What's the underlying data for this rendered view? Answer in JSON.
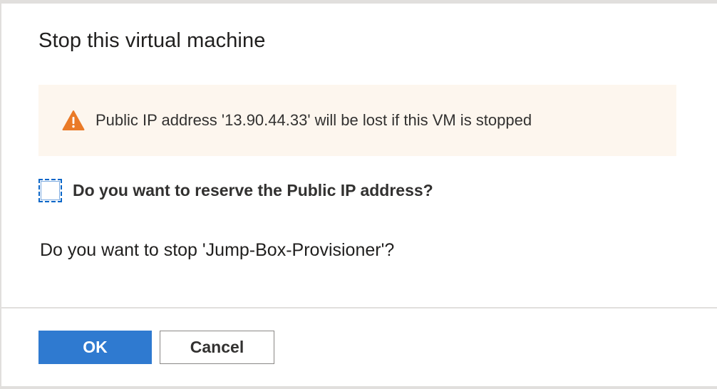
{
  "dialog": {
    "title": "Stop this virtual machine",
    "warning": {
      "icon": "warning-triangle-icon",
      "text": "Public IP address '13.90.44.33' will be lost if this VM is stopped",
      "background": "#fdf6ee",
      "icon_color": "#ea7a27"
    },
    "reserve_ip": {
      "label": "Do you want to reserve the Public IP address?",
      "checked": false
    },
    "question": "Do you want to stop 'Jump-Box-Provisioner'?",
    "buttons": {
      "ok_label": "OK",
      "cancel_label": "Cancel",
      "primary_color": "#2f7ad0"
    }
  }
}
